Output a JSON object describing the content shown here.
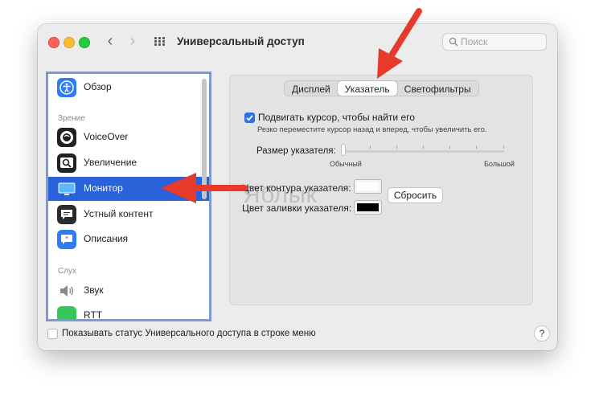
{
  "window": {
    "title": "Универсальный доступ"
  },
  "search": {
    "placeholder": "Поиск"
  },
  "sidebar": {
    "items": [
      {
        "label": "Обзор",
        "icon": "accessibility-icon",
        "color": "#2e7bf6"
      },
      {
        "label": "VoiceOver",
        "icon": "voiceover-icon",
        "color": "#222222"
      },
      {
        "label": "Увеличение",
        "icon": "zoom-icon",
        "color": "#222222"
      },
      {
        "label": "Монитор",
        "icon": "display-icon",
        "color": "#2f8cf3"
      },
      {
        "label": "Устный контент",
        "icon": "speech-bubble-icon",
        "color": "#2b2b2b"
      },
      {
        "label": "Описания",
        "icon": "descriptions-icon",
        "color": "#2e7bf6"
      },
      {
        "label": "Звук",
        "icon": "speaker-icon",
        "color": "#888888"
      },
      {
        "label": "RTT",
        "icon": "rtt-icon",
        "color": "#34c759"
      }
    ],
    "sections": {
      "vision": "Зрение",
      "hearing": "Слух"
    },
    "selected": "Монитор"
  },
  "tabs": {
    "items": [
      "Дисплей",
      "Указатель",
      "Светофильтры"
    ],
    "active": "Указатель"
  },
  "pointer": {
    "shake_label": "Подвигать курсор, чтобы найти его",
    "shake_checked": true,
    "shake_hint": "Резко переместите курсор назад и вперед, чтобы увеличить его.",
    "size_label": "Размер указателя:",
    "size_min": "Обычный",
    "size_max": "Большой",
    "size_value": 0,
    "outline_label": "Цвет контура указателя:",
    "outline_color": "#ffffff",
    "fill_label": "Цвет заливки указателя:",
    "fill_color": "#000000",
    "reset_label": "Сбросить"
  },
  "watermark": "Яблык",
  "footer": {
    "status_label": "Показывать статус Универсального доступа в строке меню",
    "help_label": "?"
  },
  "accent": "#2962d9",
  "annotation_arrow_color": "#e53a2c"
}
